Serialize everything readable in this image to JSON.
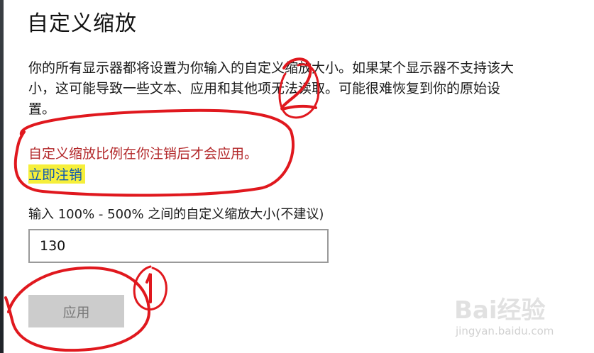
{
  "page": {
    "title": "自定义缩放",
    "description": "你的所有显示器都将设置为你输入的自定义缩放大小。如果某个显示器不支持该大小，这可能导致一些文本、应用和其他项无法读取。可能很难恢复到你的原始设置。",
    "warning": "自定义缩放比例在你注销后才会应用。",
    "signout_link": "立即注销",
    "input_label": "输入 100% - 500% 之间的自定义缩放大小(不建议)",
    "input_value": "130",
    "apply_label": "应用"
  },
  "annotations": {
    "marker_1": "1",
    "marker_2": "2",
    "color": "#e0181e"
  },
  "watermark": {
    "logo": "Bai经验",
    "url": "jingyan.baidu.com"
  }
}
